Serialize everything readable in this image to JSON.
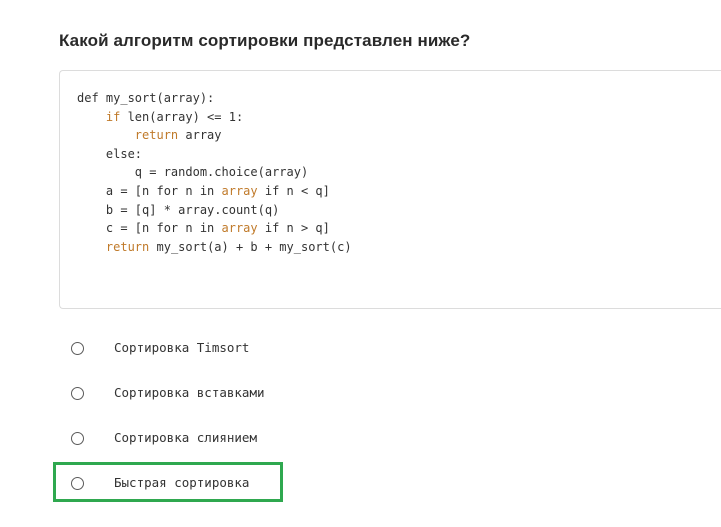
{
  "question": {
    "title": "Какой алгоритм сортировки представлен ниже?"
  },
  "code": {
    "lines": [
      [
        {
          "t": "def my_sort(array):"
        }
      ],
      [
        {
          "t": "    "
        },
        {
          "t": "if",
          "k": 1
        },
        {
          "t": " len(array) <= 1:"
        }
      ],
      [
        {
          "t": "        "
        },
        {
          "t": "return",
          "k": 1
        },
        {
          "t": " array"
        }
      ],
      [
        {
          "t": "    else:"
        }
      ],
      [
        {
          "t": "        q = random.choice(array)"
        }
      ],
      [
        {
          "t": "    a = [n for n in "
        },
        {
          "t": "array",
          "k": 1
        },
        {
          "t": " if n < q]"
        }
      ],
      [
        {
          "t": "    b = [q] * array.count(q)"
        }
      ],
      [
        {
          "t": "    c = [n for n in "
        },
        {
          "t": "array",
          "k": 1
        },
        {
          "t": " if n > q]"
        }
      ],
      [
        {
          "t": "    "
        },
        {
          "t": "return",
          "k": 1
        },
        {
          "t": " my_sort(a) + b + my_sort(c)"
        }
      ]
    ]
  },
  "options": [
    {
      "label": "Сортировка Timsort",
      "selected": false
    },
    {
      "label": "Сортировка вставками",
      "selected": false
    },
    {
      "label": "Сортировка слиянием",
      "selected": false
    },
    {
      "label": "Быстрая сортировка",
      "selected": false
    }
  ],
  "colors": {
    "keyword": "#c07a2a",
    "highlight_border": "#2fa84f"
  }
}
